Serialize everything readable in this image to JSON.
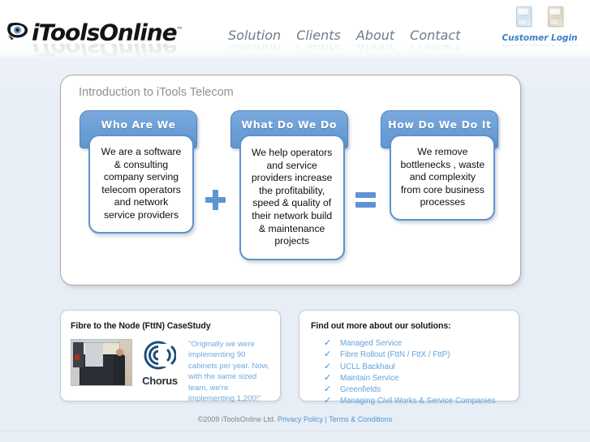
{
  "site": {
    "logo_text": "iToolsOnline",
    "logo_tm": "™",
    "logo_mark_icon": "eye-logo-icon"
  },
  "nav": {
    "items": [
      {
        "label": "Solution"
      },
      {
        "label": "Clients"
      },
      {
        "label": "About"
      },
      {
        "label": "Contact"
      }
    ]
  },
  "login": {
    "link_label": "Customer Login",
    "icons": [
      {
        "name": "booklet-blue-icon"
      },
      {
        "name": "booklet-tan-icon"
      }
    ]
  },
  "main": {
    "title": "Introduction to iTools Telecom",
    "columns": [
      {
        "tab": "Who Are We",
        "body": "We are a software & consulting company serving telecom operators and network service providers"
      },
      {
        "tab": "What Do We Do",
        "body": "We help operators and service providers increase the profitability, speed & quality of their network build & maintenance projects"
      },
      {
        "tab": "How Do We Do It",
        "body": "We remove bottlenecks , waste and complexity from core business processes"
      }
    ],
    "operators": {
      "plus": "+",
      "equals": "="
    }
  },
  "case_study": {
    "heading": "Fibre to the Node (FttN) CaseStudy",
    "photo_alt": "technician-at-street-cabinet-photo",
    "client_logo_name": "chorus-logo-icon",
    "client_name": "Chorus",
    "quote": "\"Originally we were implementing 90 cabinets per year. Now, with the same sized team, we're implementing 1,200!\""
  },
  "solutions": {
    "heading": "Find out more about our solutions:",
    "items": [
      {
        "label": "Managed Service"
      },
      {
        "label": "Fibre Rollout (FttN / FttX / FttP)"
      },
      {
        "label": "UCLL Backhaul"
      },
      {
        "label": "Maintain Service"
      },
      {
        "label": "Greenfields"
      },
      {
        "label": "Managing Civil Works & Service Companies"
      }
    ]
  },
  "footer": {
    "copyright": "©2009 iToolsOnline Ltd.",
    "privacy_label": "Privacy Policy",
    "separator": "|",
    "terms_label": "Terms & Conditions"
  },
  "colors": {
    "page_background": "#e8eef5",
    "accent_blue": "#5f94d2",
    "tab_blue": "#6c9ed6",
    "link_blue": "#62a3dc",
    "panel_border": "#a9aaab",
    "title_gray": "#8d8f92"
  }
}
